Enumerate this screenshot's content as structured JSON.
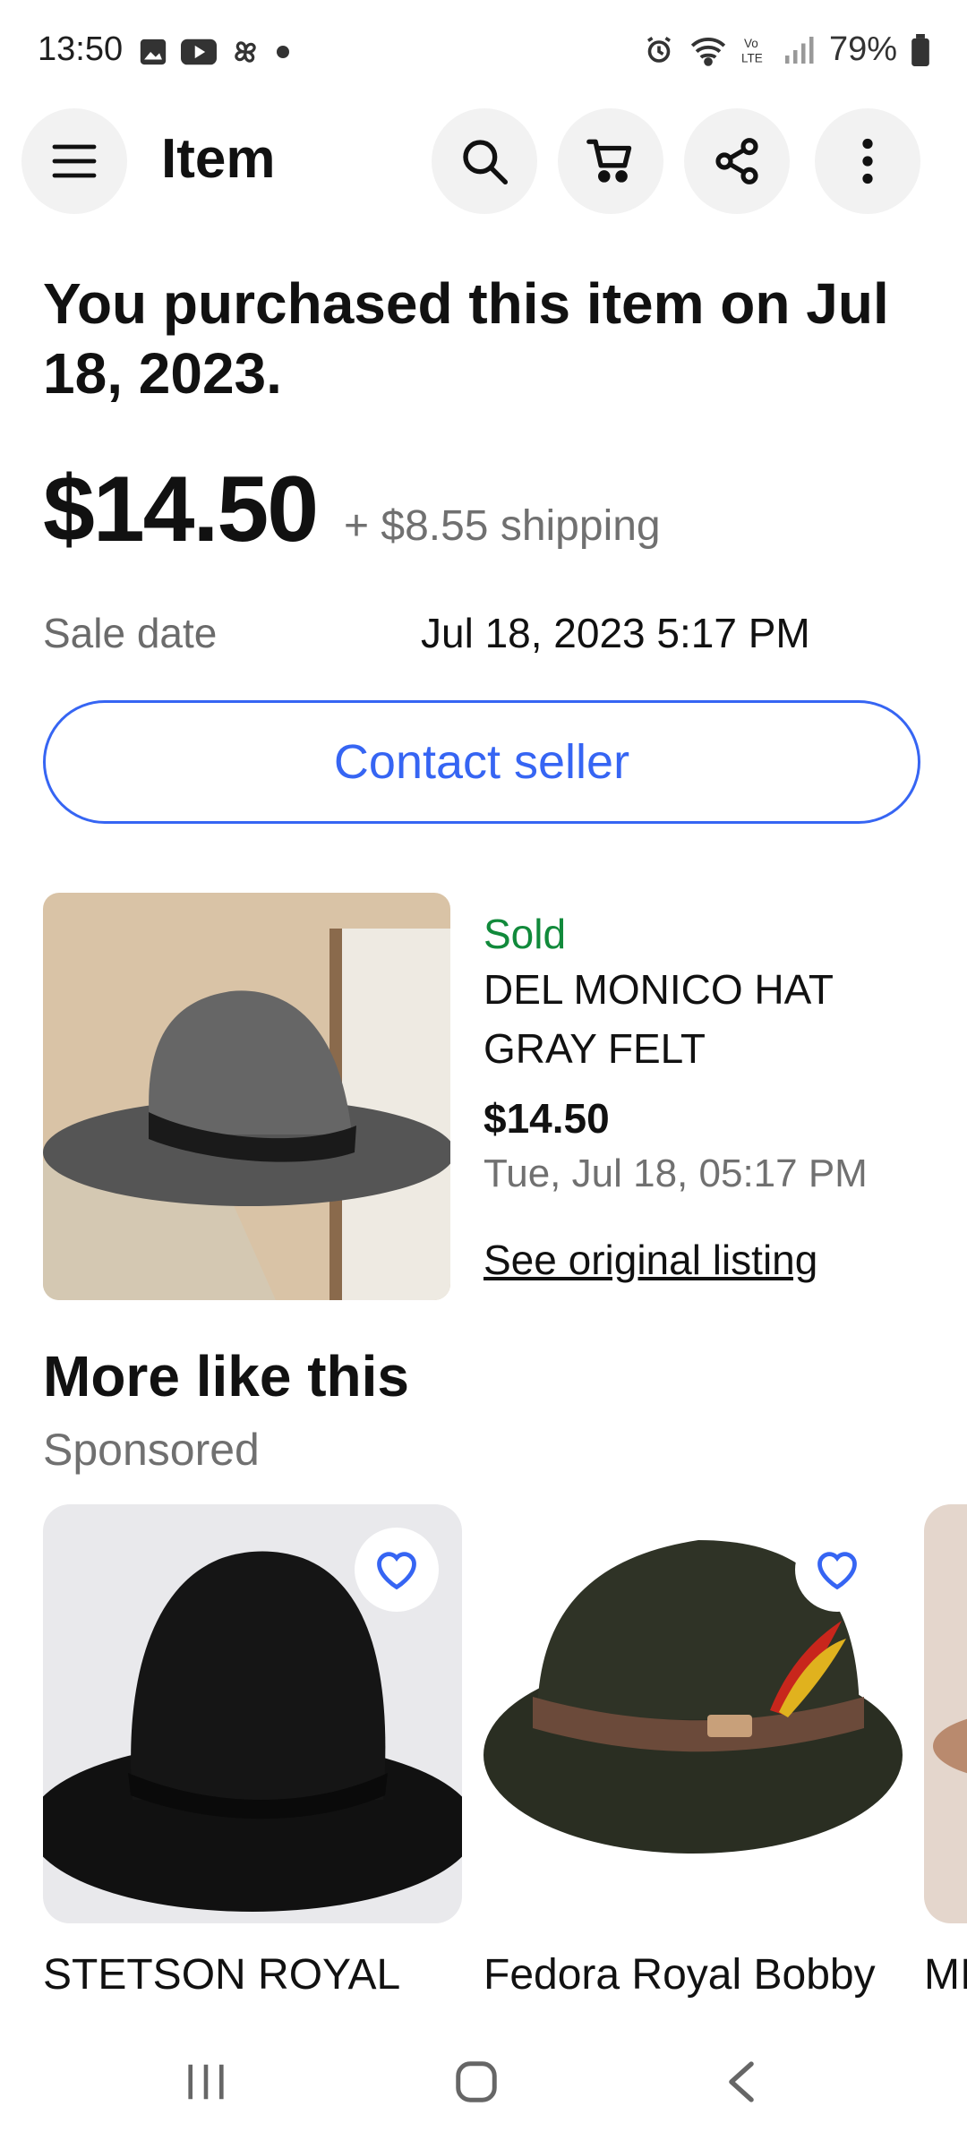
{
  "status_bar": {
    "time": "13:50",
    "battery": "79%",
    "left_icons": [
      "gallery-icon",
      "youtube-icon",
      "pinwheel-icon",
      "dot-icon"
    ],
    "right_icons": [
      "alarm-icon",
      "wifi-icon",
      "volte-icon",
      "signal-icon",
      "battery-icon"
    ]
  },
  "header": {
    "title": "Item",
    "menu_icon": "menu-icon",
    "actions": [
      "search-icon",
      "cart-icon",
      "share-icon",
      "more-vert-icon"
    ]
  },
  "purchase": {
    "message": "You purchased this item on Jul 18, 2023.",
    "price": "$14.50",
    "shipping": "+ $8.55 shipping",
    "sale_date_label": "Sale date",
    "sale_date_value": "Jul 18, 2023 5:17 PM",
    "contact_button": "Contact seller"
  },
  "item": {
    "status": "Sold",
    "title": "DEL MONICO HAT GRAY FELT",
    "price": "$14.50",
    "date": "Tue, Jul 18, 05:17 PM",
    "link": "See original listing"
  },
  "more_like_this": {
    "title": "More like this",
    "subtitle": "Sponsored",
    "cards": [
      {
        "title": "STETSON ROYAL"
      },
      {
        "title": "Fedora Royal Bobby"
      },
      {
        "title": "MI"
      }
    ]
  },
  "colors": {
    "accent": "#3665f3",
    "sold_green": "#118a3b",
    "muted_text": "#707070"
  }
}
